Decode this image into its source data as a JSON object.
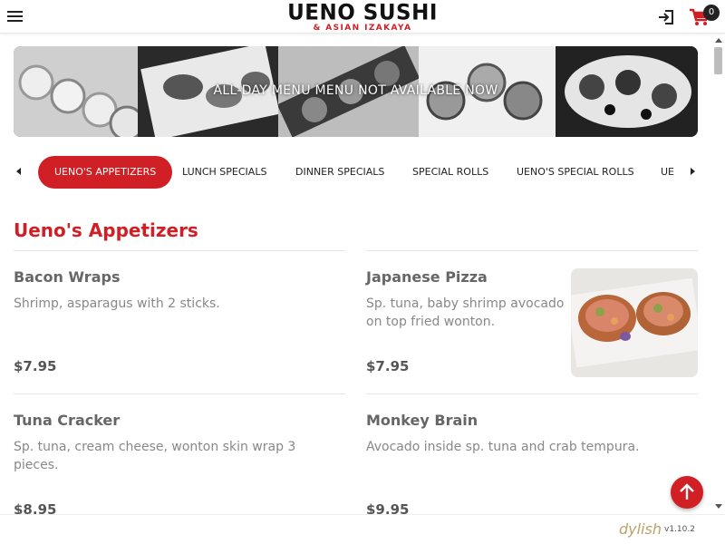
{
  "header": {
    "logo_main": "UENO SUSHI",
    "logo_sub": "& ASIAN IZAKAYA",
    "cart_count": "0"
  },
  "banner": {
    "text": "ALL-DAY MENU MENU NOT AVAILABLE NOW"
  },
  "categories": [
    {
      "label": "UENO'S APPETIZERS",
      "active": true
    },
    {
      "label": "LUNCH SPECIALS",
      "active": false
    },
    {
      "label": "DINNER SPECIALS",
      "active": false
    },
    {
      "label": "SPECIAL ROLLS",
      "active": false
    },
    {
      "label": "UENO'S SPECIAL ROLLS",
      "active": false
    },
    {
      "label": "UE",
      "active": false
    }
  ],
  "section": {
    "title": "Ueno's Appetizers",
    "items": [
      {
        "name": "Bacon Wraps",
        "description": "Shrimp, asparagus with 2 sticks.",
        "price": "$7.95",
        "has_image": false
      },
      {
        "name": "Japanese Pizza",
        "description": "Sp. tuna, baby shrimp avocado on top fried wonton.",
        "price": "$7.95",
        "has_image": true
      },
      {
        "name": "Tuna Cracker",
        "description": "Sp. tuna, cream cheese, wonton skin wrap 3 pieces.",
        "price": "$8.95",
        "has_image": false
      },
      {
        "name": "Monkey Brain",
        "description": "Avocado inside sp. tuna and crab tempura.",
        "price": "$9.95",
        "has_image": false
      }
    ]
  },
  "footer": {
    "brand": "dylish",
    "version": "v1.10.2"
  },
  "colors": {
    "accent": "#d01f25",
    "text": "#333333",
    "muted": "#888888"
  },
  "icons": {
    "menu": "hamburger-icon",
    "login": "login-icon",
    "cart": "cart-icon",
    "scroll_top": "arrow-up-icon"
  }
}
